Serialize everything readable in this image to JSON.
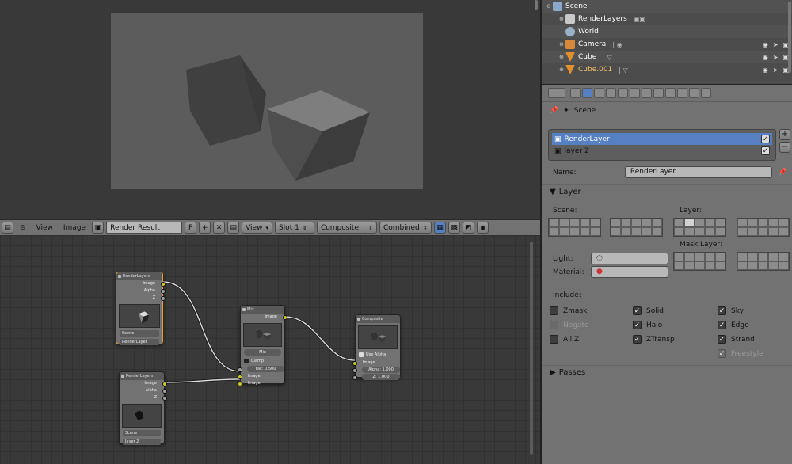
{
  "outliner": {
    "rows": [
      {
        "label": "Scene",
        "icon": "scene-icon"
      },
      {
        "label": "RenderLayers",
        "icon": "renderlayers-icon"
      },
      {
        "label": "World",
        "icon": "world-icon"
      },
      {
        "label": "Camera",
        "icon": "camera-icon"
      },
      {
        "label": "Cube",
        "icon": "mesh-icon"
      },
      {
        "label": "Cube.001",
        "icon": "mesh-icon"
      }
    ]
  },
  "ne_header": {
    "menus": [
      "View",
      "Image"
    ],
    "image_name": "Render Result",
    "fake_user": "F",
    "view_label": "View",
    "slot_label": "Slot 1",
    "composite_label": "Composite",
    "pass_label": "Combined"
  },
  "nodes": {
    "render_layers_1": {
      "title": "RenderLayers",
      "outputs": [
        "Image",
        "Alpha",
        "Z"
      ],
      "scene": "Scene",
      "layer": "RenderLayer"
    },
    "render_layers_2": {
      "title": "RenderLayers",
      "outputs": [
        "Image",
        "Alpha",
        "Z"
      ],
      "scene": "Scene",
      "layer": "layer 2"
    },
    "mix": {
      "title": "Mix",
      "output": "Image",
      "blend": "Mix",
      "clamp": "Clamp",
      "fac": "Fac: 0.500",
      "inputs": [
        "Image",
        "Image"
      ]
    },
    "composite": {
      "title": "Composite",
      "use_alpha": "Use Alpha",
      "input": "Image",
      "alpha": "Alpha: 1.000",
      "z": "Z: 1.000"
    }
  },
  "props": {
    "crumb": "Scene",
    "layers": [
      {
        "name": "RenderLayer",
        "active": true
      },
      {
        "name": "layer 2",
        "active": false
      }
    ],
    "name_label": "Name:",
    "name_value": "RenderLayer",
    "layer_panel": "Layer",
    "scene_label": "Scene:",
    "layer_label": "Layer:",
    "mask_layer_label": "Mask Layer:",
    "light_label": "Light:",
    "material_label": "Material:",
    "include_label": "Include:",
    "include": {
      "zmask": "Zmask",
      "negate": "Negate",
      "allz": "All Z",
      "solid": "Solid",
      "halo": "Halo",
      "ztransp": "ZTransp",
      "sky": "Sky",
      "edge": "Edge",
      "strand": "Strand",
      "freestyle": "Freestyle"
    },
    "passes_panel": "Passes"
  }
}
